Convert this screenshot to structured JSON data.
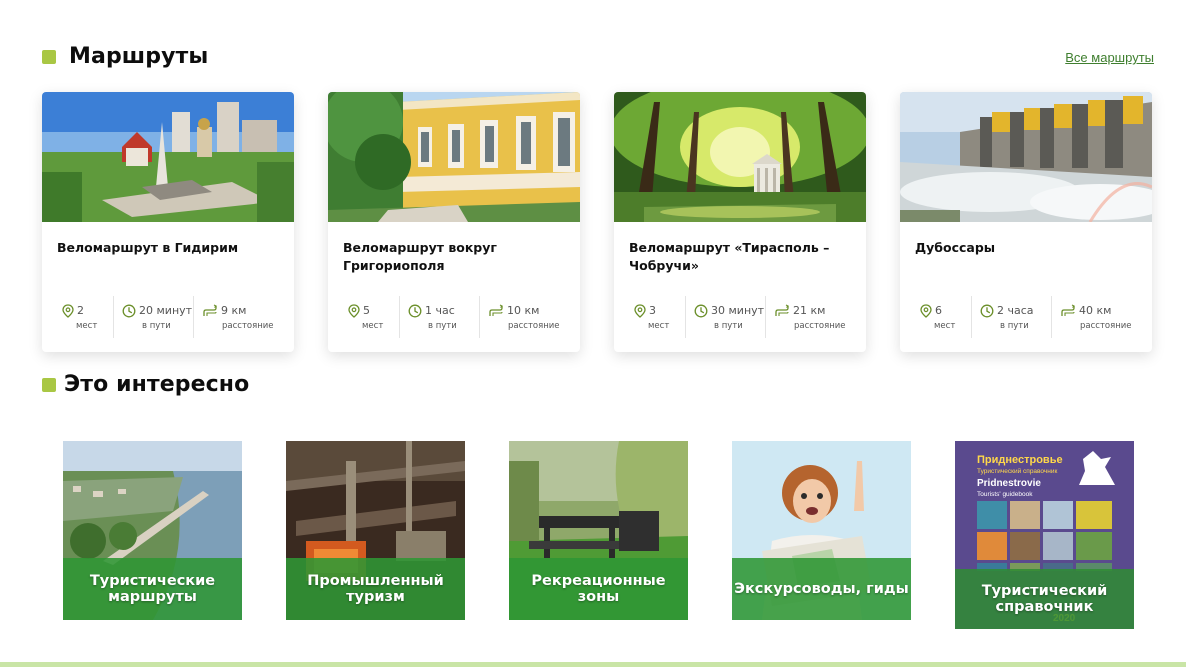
{
  "routes": {
    "title": "Маршруты",
    "all_link": "Все маршруты",
    "cards": [
      {
        "title": "Веломаршрут в Гидирим",
        "places": "2",
        "places_unit": "мест",
        "time": "20 минут",
        "time_unit": "в пути",
        "distance": "9 км",
        "distance_unit": "расстояние"
      },
      {
        "title": "Веломаршрут вокруг Григориополя",
        "places": "5",
        "places_unit": "мест",
        "time": "1 час",
        "time_unit": "в пути",
        "distance": "10 км",
        "distance_unit": "расстояние"
      },
      {
        "title": "Веломаршрут «Тирасполь – Чобручи»",
        "places": "3",
        "places_unit": "мест",
        "time": "30 минут",
        "time_unit": "в пути",
        "distance": "21 км",
        "distance_unit": "расстояние"
      },
      {
        "title": "Дубоссары",
        "places": "6",
        "places_unit": "мест",
        "time": "2 часа",
        "time_unit": "в пути",
        "distance": "40 км",
        "distance_unit": "расстояние"
      }
    ]
  },
  "interesting": {
    "title": "Это интересно",
    "tiles": [
      {
        "label": "Туристические маршруты"
      },
      {
        "label": "Промышленный туризм"
      },
      {
        "label": "Рекреационные зоны"
      },
      {
        "label": "Экскурсоводы, гиды"
      },
      {
        "label": "Туристический справочник"
      }
    ],
    "guidebook_cover": {
      "title_ru": "Приднестровье",
      "subtitle_ru": "Туристический справочник",
      "title_en": "Pridnestrovie",
      "subtitle_en": "Tourists' guidebook",
      "year": "2020"
    }
  },
  "colors": {
    "accent": "#a9c744",
    "link": "#3f7f2f",
    "tile_overlay": "#2f9634",
    "bottom_bar": "#c9e5a6"
  },
  "icons": {
    "places": "location-pin-icon",
    "time": "clock-icon",
    "distance": "route-icon"
  }
}
